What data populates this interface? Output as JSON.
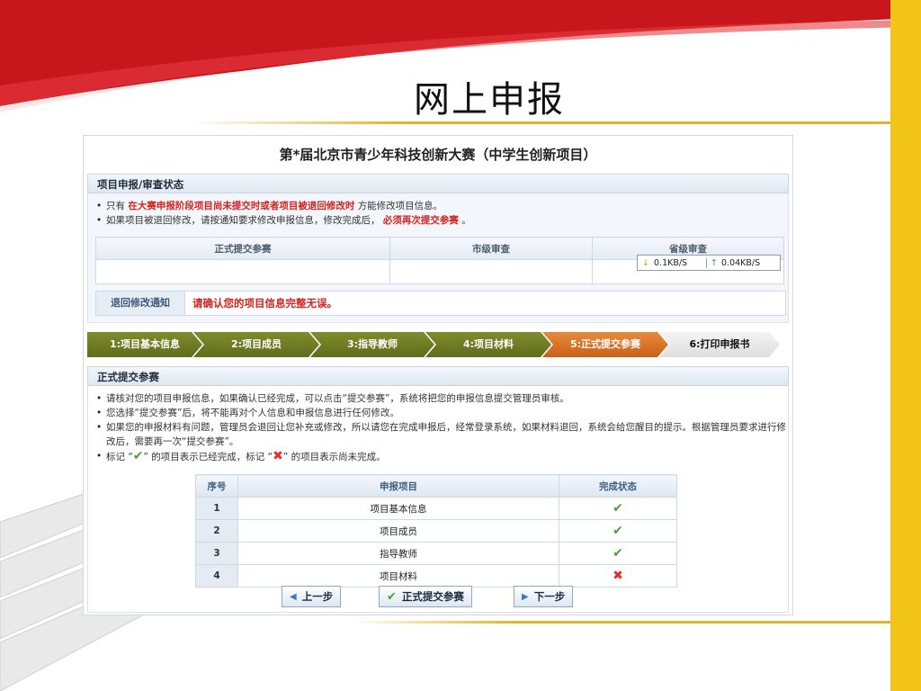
{
  "slide": {
    "title": "网上申报"
  },
  "contest_title": "第*届北京市青少年科技创新大赛（中学生创新项目）",
  "status_panel": {
    "header": "项目申报/审查状态",
    "bullet1_pre": "只有",
    "bullet1_red": "在大赛申报阶段项目尚未提交时或者项目被退回修改时",
    "bullet1_post": "方能修改项目信息。",
    "bullet2_pre": "如果项目被退回修改，请按通知要求修改申报信息，修改完成后，",
    "bullet2_red": "必须再次提交参赛",
    "bullet2_post": "。",
    "columns": [
      "正式提交参赛",
      "市级审查",
      "省级审查"
    ],
    "speed_down": "0.1KB/S",
    "speed_up": "0.04KB/S",
    "notice_label": "退回修改通知",
    "notice_text": "请确认您的项目信息完整无误。"
  },
  "steps": [
    {
      "label": "1:项目基本信息",
      "state": "done"
    },
    {
      "label": "2:项目成员",
      "state": "done"
    },
    {
      "label": "3:指导教师",
      "state": "done"
    },
    {
      "label": "4:项目材料",
      "state": "done"
    },
    {
      "label": "5:正式提交参赛",
      "state": "active"
    },
    {
      "label": "6:打印申报书",
      "state": "todo"
    }
  ],
  "submit_panel": {
    "header": "正式提交参赛",
    "bullets": [
      "请核对您的项目申报信息，如果确认已经完成，可以点击“提交参赛”，系统将把您的申报信息提交管理员审核。",
      "您选择“提交参赛”后，将不能再对个人信息和申报信息进行任何修改。",
      "如果您的申报材料有问题，管理员会退回让您补充或修改，所以请您在完成申报后，经常登录系统，如果材料退回，系统会给您醒目的提示。根据管理员要求进行修改后，需要再一次“提交参赛”。"
    ],
    "legend_pre": "标记 “",
    "legend_mid": "” 的项目表示已经完成，标记 “",
    "legend_post": "” 的项目表示尚未完成。"
  },
  "completion_table": {
    "headers": [
      "序号",
      "申报项目",
      "完成状态"
    ],
    "rows": [
      {
        "idx": "1",
        "item": "项目基本信息",
        "status": "done"
      },
      {
        "idx": "2",
        "item": "项目成员",
        "status": "done"
      },
      {
        "idx": "3",
        "item": "指导教师",
        "status": "done"
      },
      {
        "idx": "4",
        "item": "项目材料",
        "status": "not-done"
      }
    ]
  },
  "buttons": {
    "prev": "上一步",
    "submit": "正式提交参赛",
    "next": "下一步"
  },
  "colors": {
    "accent_red": "#d2231e",
    "step_done": "#6e7b24",
    "step_active": "#d9722a",
    "check_green": "#4aa13a",
    "cross_red": "#e0302a"
  }
}
